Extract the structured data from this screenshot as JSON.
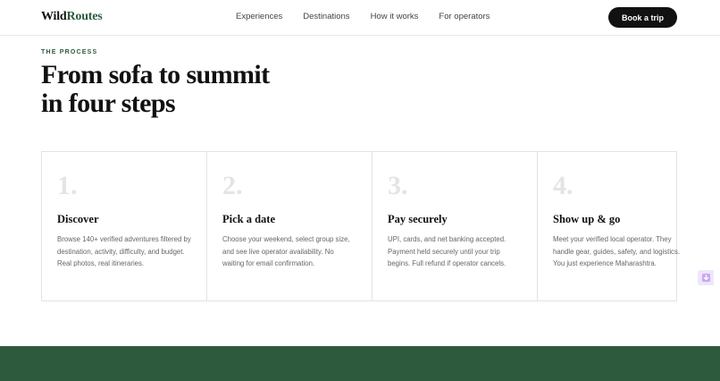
{
  "nav": {
    "logo_main": "Wild",
    "logo_accent": "Routes",
    "links": [
      "Experiences",
      "Destinations",
      "How it works",
      "For operators"
    ],
    "cta_label": "Book a trip"
  },
  "hero": {
    "eyebrow": "THE PROCESS",
    "headline_line1": "From sofa to summit",
    "headline_line2": "in four steps"
  },
  "steps": [
    {
      "number": "1.",
      "title": "Discover",
      "body": "Browse 140+ verified adventures filtered by destination, activity, difficulty, and budget. Real photos, real itineraries."
    },
    {
      "number": "2.",
      "title": "Pick a date",
      "body": "Choose your weekend, select group size, and see live operator availability. No waiting for email confirmation."
    },
    {
      "number": "3.",
      "title": "Pay securely",
      "body": "UPI, cards, and net banking accepted. Payment held securely until your trip begins. Full refund if operator cancels."
    },
    {
      "number": "4.",
      "title": "Show up & go",
      "body": "Meet your verified local operator. They handle gear, guides, safety, and logistics. You just experience Maharashtra."
    }
  ],
  "colors": {
    "brand_green": "#2d5a3d",
    "cta_background": "#111111",
    "floating_widget": "#efe6fb"
  },
  "icons": {
    "floating_widget": "download-icon"
  }
}
